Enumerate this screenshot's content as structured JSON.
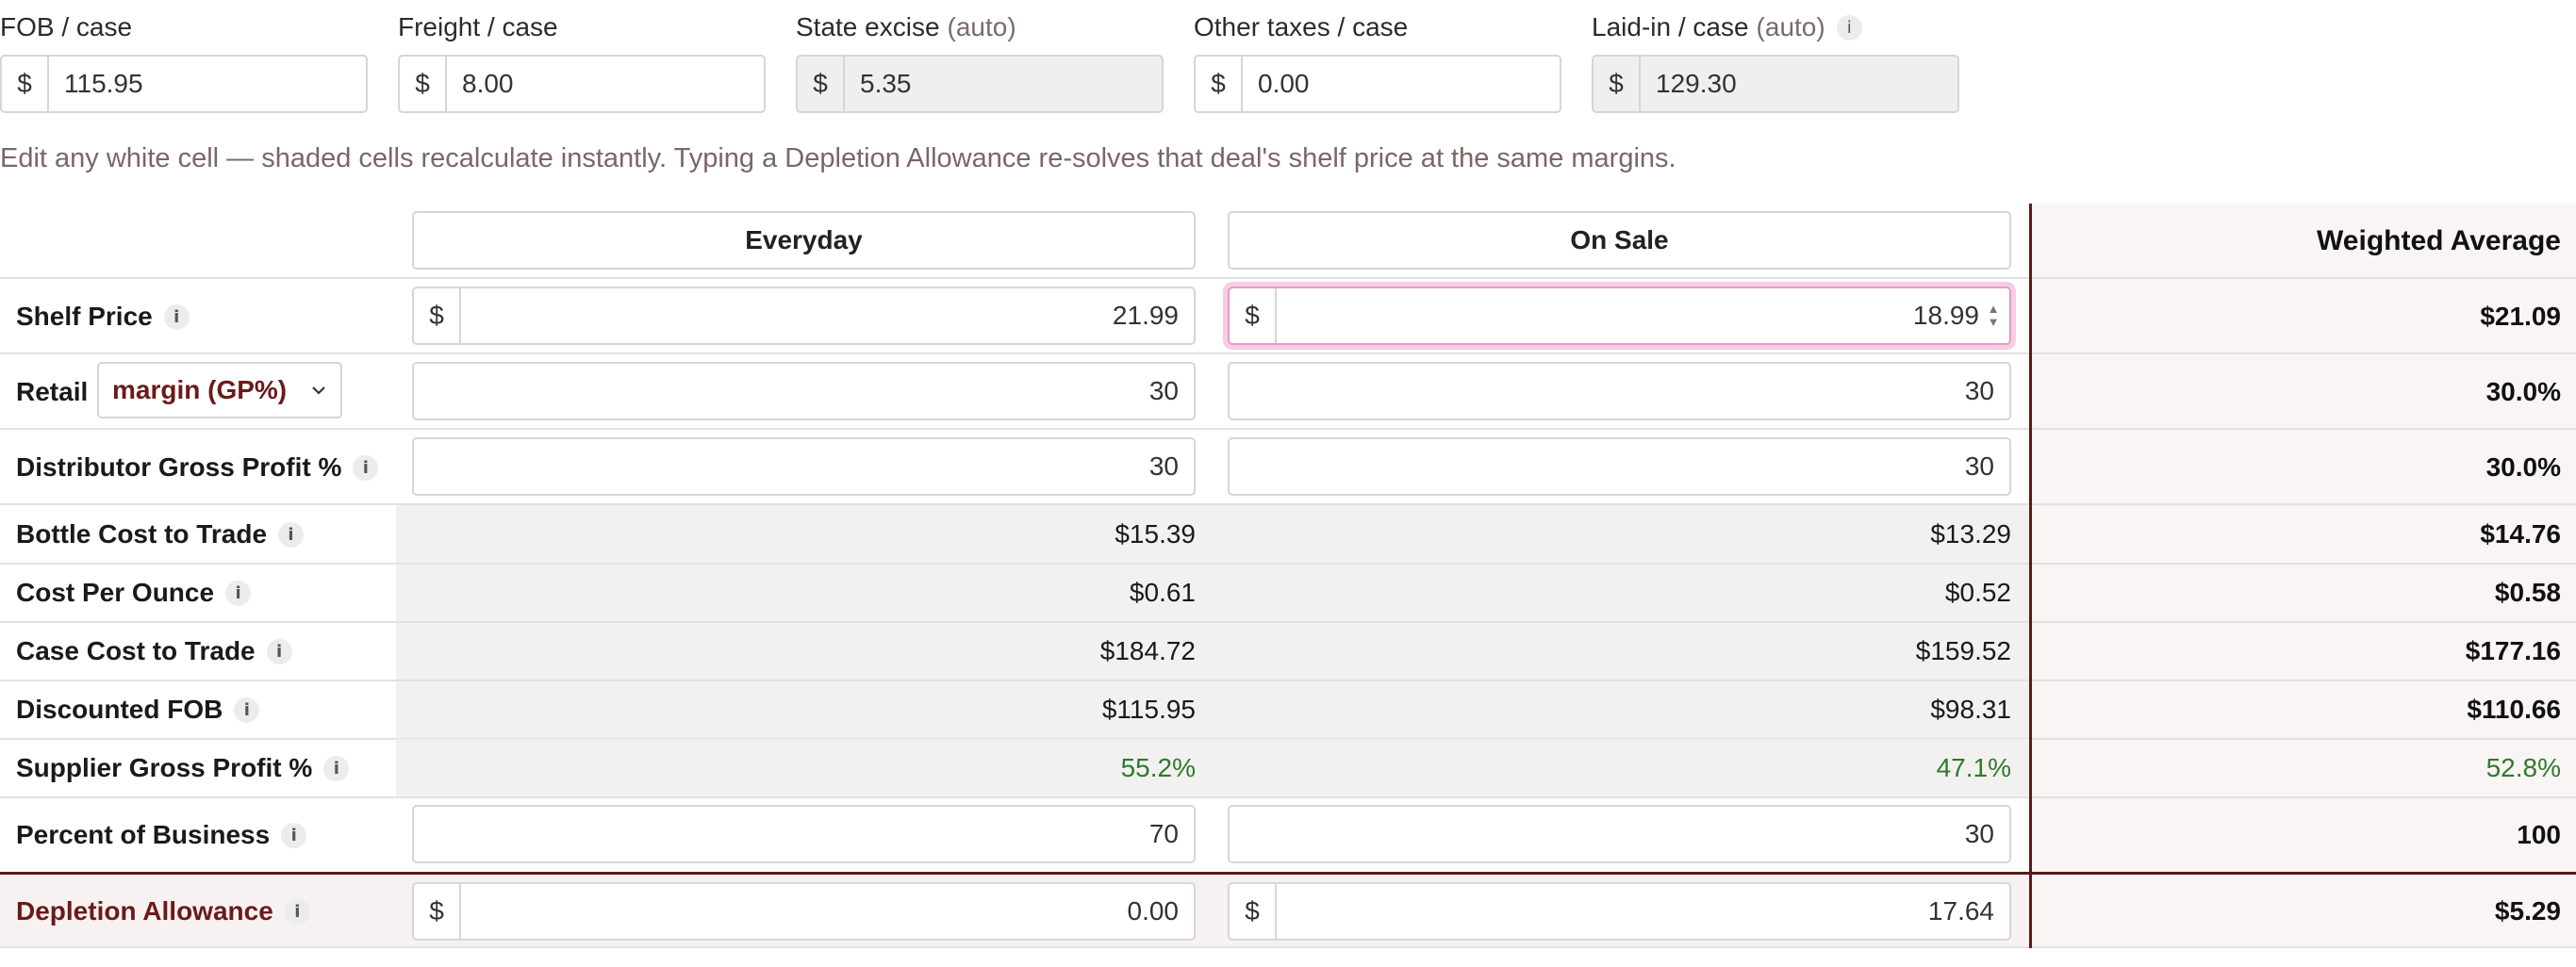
{
  "top_fields": [
    {
      "label": "FOB / case",
      "auto": "",
      "prefix": "$",
      "value": "115.95",
      "shaded": false
    },
    {
      "label": "Freight / case",
      "auto": "",
      "prefix": "$",
      "value": "8.00",
      "shaded": false
    },
    {
      "label": "State excise",
      "auto": "(auto)",
      "prefix": "$",
      "value": "5.35",
      "shaded": true
    },
    {
      "label": "Other taxes / case",
      "auto": "",
      "prefix": "$",
      "value": "0.00",
      "shaded": false
    },
    {
      "label": "Laid-in / case",
      "auto": "(auto)",
      "prefix": "$",
      "value": "129.30",
      "shaded": true,
      "info": "i"
    }
  ],
  "note": "Edit any white cell — shaded cells recalculate instantly. Typing a Depletion Allowance re-solves that deal's shelf price at the same margins.",
  "columns": {
    "everyday": "Everyday",
    "on_sale": "On Sale",
    "weighted": "Weighted Average"
  },
  "info_glyph": "i",
  "rows": {
    "shelf_price": {
      "label": "Shelf Price",
      "prefix": "$",
      "everyday": "21.99",
      "on_sale": "18.99",
      "weighted": "$21.09"
    },
    "retail": {
      "label": "Retail",
      "select": "margin (GP%)",
      "everyday": "30",
      "on_sale": "30",
      "weighted": "30.0%"
    },
    "distributor_gp": {
      "label": "Distributor Gross Profit %",
      "everyday": "30",
      "on_sale": "30",
      "weighted": "30.0%"
    },
    "bottle_cost": {
      "label": "Bottle Cost to Trade",
      "everyday": "$15.39",
      "on_sale": "$13.29",
      "weighted": "$14.76"
    },
    "cost_per_ounce": {
      "label": "Cost Per Ounce",
      "everyday": "$0.61",
      "on_sale": "$0.52",
      "weighted": "$0.58"
    },
    "case_cost": {
      "label": "Case Cost to Trade",
      "everyday": "$184.72",
      "on_sale": "$159.52",
      "weighted": "$177.16"
    },
    "discounted_fob": {
      "label": "Discounted FOB",
      "everyday": "$115.95",
      "on_sale": "$98.31",
      "weighted": "$110.66"
    },
    "supplier_gp": {
      "label": "Supplier Gross Profit %",
      "everyday": "55.2%",
      "on_sale": "47.1%",
      "weighted": "52.8%"
    },
    "percent_business": {
      "label": "Percent of Business",
      "everyday": "70",
      "on_sale": "30",
      "weighted": "100"
    },
    "depletion": {
      "label": "Depletion Allowance",
      "prefix": "$",
      "everyday": "0.00",
      "on_sale": "17.64",
      "weighted": "$5.29"
    }
  },
  "colors": {
    "accent": "#5a1a1a",
    "positive": "#2d7a2d",
    "focus": "#e79ac6"
  }
}
